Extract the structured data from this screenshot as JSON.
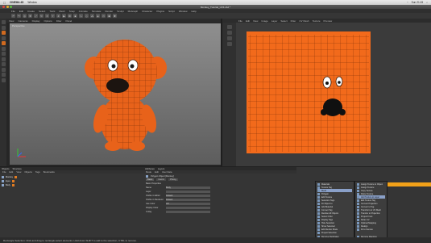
{
  "mac_menu": {
    "app_name": "CINEMA 4D",
    "items": [
      "Window"
    ],
    "clock": "Sun 21:15"
  },
  "window": {
    "title": "Monkey_Tutorial_UV4.c4d *"
  },
  "main_menu": [
    "File",
    "Edit",
    "Create",
    "Select",
    "Tools",
    "Mesh",
    "Snap",
    "Animate",
    "Simulate",
    "Render",
    "Sculpt",
    "MoGraph",
    "Character",
    "Plugins",
    "Script",
    "Window",
    "Help"
  ],
  "left_viewport": {
    "menu": [
      "View",
      "Cameras",
      "Display",
      "Options",
      "Filter",
      "Panel"
    ],
    "label": "Perspective"
  },
  "uv_viewport": {
    "menu": [
      "File",
      "Edit",
      "View",
      "Image",
      "Layer",
      "Select",
      "Filter",
      "UV Mesh",
      "Texture",
      "Preview"
    ]
  },
  "objects_panel": {
    "tabs": [
      "Objects",
      "Structure"
    ],
    "menu": [
      "File",
      "Edit",
      "View",
      "Objects",
      "Tags",
      "Bookmarks"
    ],
    "rows": [
      {
        "name": "Monkey"
      },
      {
        "name": "Eyes"
      },
      {
        "name": "Body"
      }
    ]
  },
  "attributes_panel": {
    "tabs": [
      "Attributes",
      "Layers"
    ],
    "menu": [
      "Mode",
      "Edit",
      "User Data"
    ],
    "header": "Polygon Object [Monkey]",
    "buttons": [
      "Basic",
      "Coord.",
      "Phong"
    ],
    "section": "Basic Properties",
    "rows": [
      {
        "label": "Name",
        "value": "Body"
      },
      {
        "label": "Layer",
        "value": ""
      },
      {
        "label": "Visible in Editor",
        "value": "Default"
      },
      {
        "label": "Visible in Renderer",
        "value": "Default"
      },
      {
        "label": "Use Color",
        "value": "Off"
      },
      {
        "label": "Display Color",
        "value": ""
      },
      {
        "label": "X-Ray",
        "value": ""
      }
    ]
  },
  "context_menu": {
    "items": [
      "Materials",
      "Texture Tag",
      "Mesh",
      "Polygon",
      "Edit Texture",
      "Selection Tags",
      "Fit Object to",
      "Add Material",
      "Convert Tag",
      "Redraw All Objects",
      "Select Child",
      "Display Tags",
      "Hide Selection",
      "Show Selected",
      "Edit Render Mode",
      "Project Selection",
      "Remove Duplicates"
    ],
    "selected_index": 2
  },
  "context_submenu": {
    "items": [
      "Assign Texture to Object",
      "Assign Texture",
      "Copy Texture",
      "Paste Texture",
      "Add Texture to Layer",
      "Edit Texture Tag",
      "Convert Projection",
      "Convert to Tag",
      "Transform to UV Mesh",
      "Transfer to Projection",
      "Project Front",
      "Relax UV",
      "Optimal Mapping",
      "Realign",
      "Fit to Canvas",
      "Remove Mapping"
    ],
    "selected_index": 4
  },
  "status_bar": {
    "text": "Rectangle Selection: Click and drag to rectangle-select elements. Hold down SHIFT to add to the selection, CTRL to remove."
  },
  "colors": {
    "accent_orange": "#e8621a",
    "uv_orange": "#f26a1b",
    "highlight_yellow": "#f2a119"
  }
}
